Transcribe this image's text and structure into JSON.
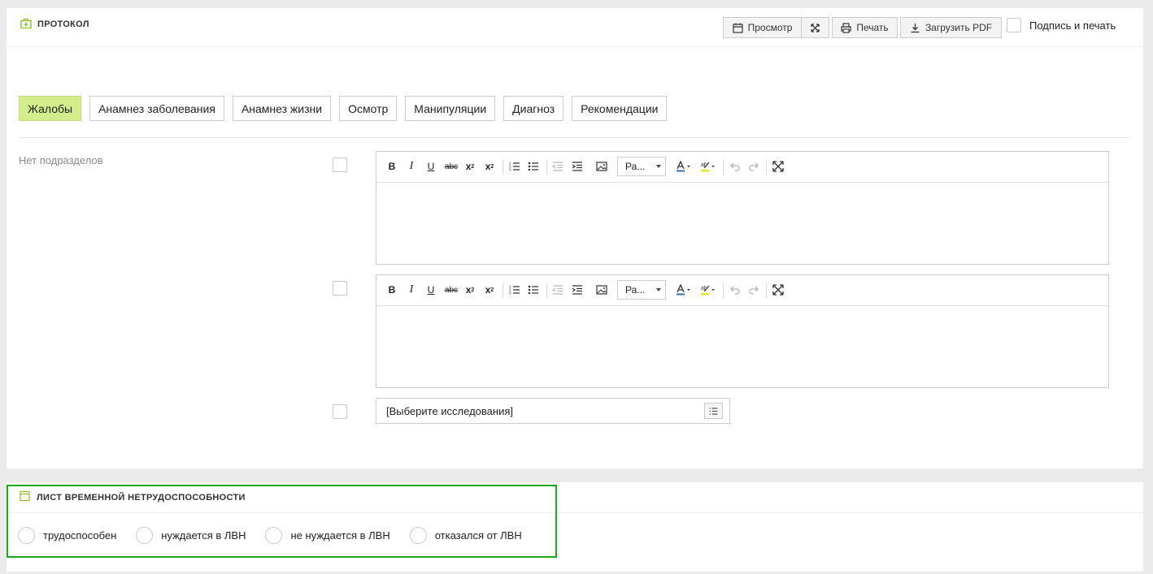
{
  "protocol": {
    "title": "ПРОТОКОЛ",
    "icon": "medkit-icon",
    "buttons": {
      "preview": "Просмотр",
      "print": "Печать",
      "download_pdf": "Загрузить PDF"
    },
    "sign_label": "Подпись и печать",
    "tabs": [
      {
        "label": "Жалобы",
        "active": true
      },
      {
        "label": "Анамнез заболевания"
      },
      {
        "label": "Анамнез жизни"
      },
      {
        "label": "Осмотр"
      },
      {
        "label": "Манипуляции"
      },
      {
        "label": "Диагноз"
      },
      {
        "label": "Рекомендации"
      }
    ],
    "no_subsections": "Нет подразделов",
    "editor": {
      "format_select": "Ра...",
      "tools": [
        "bold-icon",
        "italic-icon",
        "underline-icon",
        "strikethrough-icon",
        "subscript-icon",
        "superscript-icon",
        "ordered-list-icon",
        "bullet-list-icon",
        "outdent-icon",
        "indent-icon",
        "image-icon",
        "font-color-icon",
        "highlight-color-icon",
        "undo-icon",
        "redo-icon",
        "fullscreen-icon"
      ]
    },
    "research_placeholder": "[Выберите исследования]",
    "accent_color": "#d3ed8c"
  },
  "lvn": {
    "title": "ЛИСТ ВРЕМЕННОЙ НЕТРУДОСПОСОБНОСТИ",
    "icon": "calendar-icon",
    "options": [
      "трудоспособен",
      "нуждается в ЛВН",
      "не нуждается в ЛВН",
      "отказался от ЛВН"
    ],
    "highlight_color": "#1aaa1a"
  }
}
